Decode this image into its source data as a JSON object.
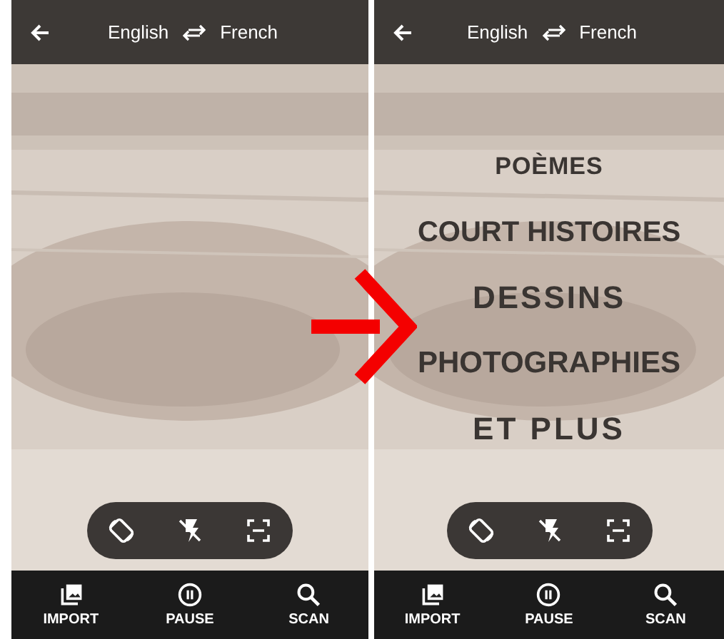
{
  "panels": [
    {
      "top_bar": {
        "source_language": "English",
        "target_language": "French"
      },
      "bottom_nav": [
        {
          "kind": "import",
          "label": "IMPORT"
        },
        {
          "kind": "pause",
          "label": "PAUSE"
        },
        {
          "kind": "scan",
          "label": "SCAN"
        }
      ]
    },
    {
      "top_bar": {
        "source_language": "English",
        "target_language": "French"
      },
      "translations": [
        "POÈMES",
        "COURT HISTOIRES",
        "DESSINS",
        "PHOTOGRAPHIES",
        "ET PLUS"
      ],
      "bottom_nav": [
        {
          "kind": "import",
          "label": "IMPORT"
        },
        {
          "kind": "pause",
          "label": "PAUSE"
        },
        {
          "kind": "scan",
          "label": "SCAN"
        }
      ]
    }
  ]
}
